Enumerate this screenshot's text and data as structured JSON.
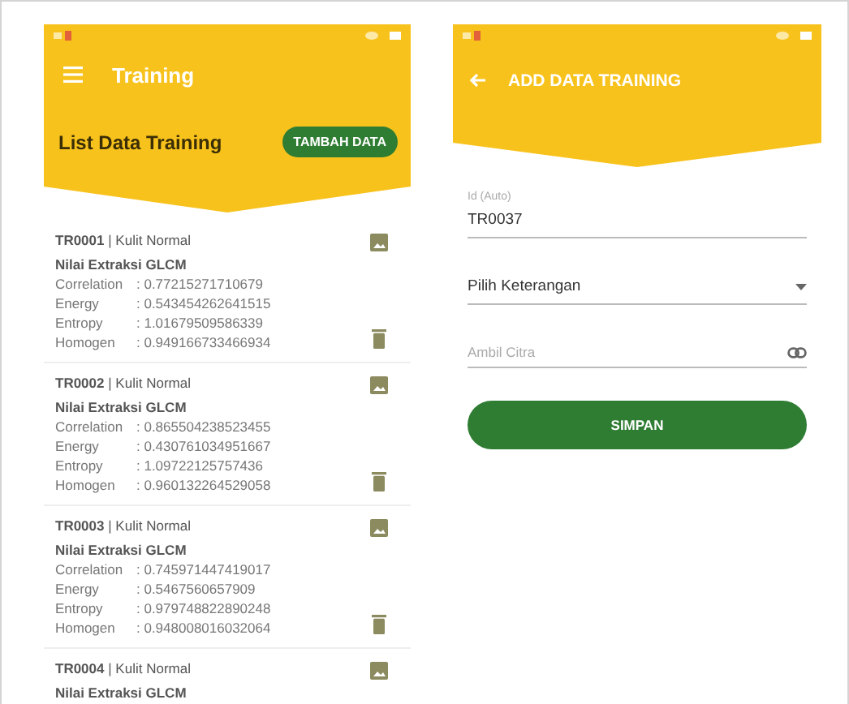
{
  "list_screen": {
    "title": "Training",
    "section_title": "List Data Training",
    "add_button": "TAMBAH DATA",
    "items": [
      {
        "heading": "**TR0001** | Kulit Normal",
        "subheading": "Nilai Extraksi GLCM",
        "features": [
          {
            "name": "Correlation",
            "value": ": 0.77215271710679"
          },
          {
            "name": "Energy",
            "value": ": 0.543454262641515"
          },
          {
            "name": "Entropy",
            "value": ": 1.01679509586339"
          },
          {
            "name": "Homogen",
            "value": ": 0.949166733466934"
          }
        ]
      },
      {
        "heading": "**TR0002** | Kulit Normal",
        "subheading": "Nilai Extraksi GLCM",
        "features": [
          {
            "name": "Correlation",
            "value": ": 0.865504238523455"
          },
          {
            "name": "Energy",
            "value": ": 0.430761034951667"
          },
          {
            "name": "Entropy",
            "value": ": 1.09722125757436"
          },
          {
            "name": "Homogen",
            "value": ": 0.960132264529058"
          }
        ]
      },
      {
        "heading": "**TR0003** | Kulit Normal",
        "subheading": "Nilai Extraksi GLCM",
        "features": [
          {
            "name": "Correlation",
            "value": ": 0.745971447419017"
          },
          {
            "name": "Energy",
            "value": ": 0.5467560657909"
          },
          {
            "name": "Entropy",
            "value": ": 0.979748822890248"
          },
          {
            "name": "Homogen",
            "value": ": 0.948008016032064"
          }
        ]
      },
      {
        "heading": "**TR0004** | Kulit Normal",
        "subheading": "Nilai Extraksi GLCM"
      }
    ]
  },
  "form_screen": {
    "title": "ADD DATA TRAINING",
    "fields": [
      {
        "kind": "text",
        "label": "Id (Auto)",
        "value": "TR0037"
      },
      {
        "kind": "dropdown",
        "value": "Pilih Keterangan"
      },
      {
        "kind": "image",
        "placeholder": "Ambil Citra"
      }
    ],
    "submit_button": "SIMPAN"
  }
}
